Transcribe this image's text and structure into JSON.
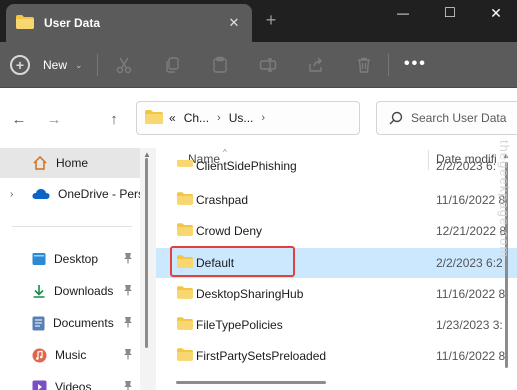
{
  "window": {
    "tab_title": "User Data",
    "tab_close": "✕",
    "new_tab": "+",
    "minimize": "—",
    "maximize": "□",
    "close": "✕"
  },
  "toolbar": {
    "new_label": "New",
    "new_icon_glyph": "+",
    "new_chevron": "⌄",
    "more_label": "•••",
    "icons": [
      "cut-icon",
      "copy-icon",
      "paste-icon",
      "rename-icon",
      "share-icon",
      "delete-icon"
    ]
  },
  "nav": {
    "back": "←",
    "forward": "→",
    "up": "↑"
  },
  "address": {
    "crumbs": [
      "«",
      "Ch...",
      "›",
      "Us...",
      "›"
    ]
  },
  "search": {
    "placeholder": "Search User Data"
  },
  "sidebar": {
    "items": [
      {
        "label": "Home",
        "icon": "home-icon",
        "pinned": false
      },
      {
        "label": "OneDrive - Pers",
        "icon": "onedrive-icon",
        "pinned": false,
        "expand": "›"
      },
      {
        "label": "Desktop",
        "icon": "desktop-icon",
        "pinned": true
      },
      {
        "label": "Downloads",
        "icon": "download-icon",
        "pinned": true
      },
      {
        "label": "Documents",
        "icon": "documents-icon",
        "pinned": true
      },
      {
        "label": "Music",
        "icon": "music-icon",
        "pinned": true
      },
      {
        "label": "Videos",
        "icon": "videos-icon",
        "pinned": true
      }
    ]
  },
  "columns": {
    "name": "Name",
    "date": "Date modifi",
    "sort_arrow": "^"
  },
  "rows": [
    {
      "name": "ClientSidePhishing",
      "date": "2/2/2023 6:"
    },
    {
      "name": "Crashpad",
      "date": "11/16/2022 8"
    },
    {
      "name": "Crowd Deny",
      "date": "12/21/2022 8"
    },
    {
      "name": "Default",
      "date": "2/2/2023 6:2",
      "selected": true
    },
    {
      "name": "DesktopSharingHub",
      "date": "11/16/2022 8"
    },
    {
      "name": "FileTypePolicies",
      "date": "1/23/2023 3:"
    },
    {
      "name": "FirstPartySetsPreloaded",
      "date": "11/16/2022 8"
    }
  ],
  "watermark": "thegeekpage.com",
  "colors": {
    "title_bar": "#202020",
    "toolbar": "#5b5b5b",
    "selection": "#cce8ff",
    "highlight_box": "#e0413c",
    "folder": "#f4c542"
  }
}
